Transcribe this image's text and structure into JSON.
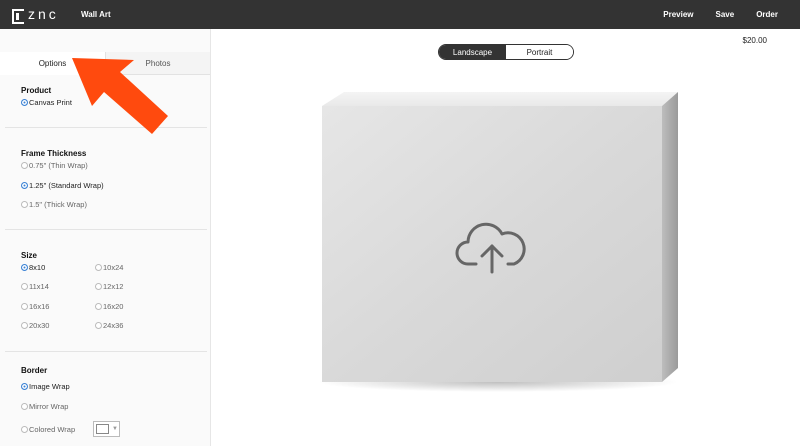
{
  "header": {
    "logo_text": "znc",
    "app_title": "Wall Art",
    "nav": [
      "Preview",
      "Save",
      "Order"
    ]
  },
  "tabs": [
    {
      "label": "Options",
      "active": true
    },
    {
      "label": "Photos",
      "active": false
    }
  ],
  "product": {
    "title": "Product",
    "options": [
      {
        "label": "Canvas Print",
        "selected": true
      }
    ]
  },
  "frame_thickness": {
    "title": "Frame Thickness",
    "options": [
      {
        "label": "0.75\" (Thin Wrap)",
        "selected": false
      },
      {
        "label": "1.25\" (Standard Wrap)",
        "selected": true
      },
      {
        "label": "1.5\" (Thick Wrap)",
        "selected": false
      }
    ]
  },
  "size": {
    "title": "Size",
    "options": [
      {
        "label": "8x10",
        "selected": true
      },
      {
        "label": "10x24",
        "selected": false
      },
      {
        "label": "11x14",
        "selected": false
      },
      {
        "label": "12x12",
        "selected": false
      },
      {
        "label": "16x16",
        "selected": false
      },
      {
        "label": "16x20",
        "selected": false
      },
      {
        "label": "20x30",
        "selected": false
      },
      {
        "label": "24x36",
        "selected": false
      }
    ]
  },
  "border": {
    "title": "Border",
    "options": [
      {
        "label": "Image Wrap",
        "selected": true
      },
      {
        "label": "Mirror Wrap",
        "selected": false
      },
      {
        "label": "Colored Wrap",
        "selected": false
      }
    ],
    "color_value": "#ffffff"
  },
  "orientation": {
    "landscape": "Landscape",
    "portrait": "Portrait",
    "selected": "Landscape"
  },
  "price": "$20.00",
  "canvas": {
    "icon": "cloud-upload-icon"
  },
  "colors": {
    "topbar": "#333333",
    "radio_selected": "#3b82d4",
    "annotation_arrow": "#ff4a0e"
  }
}
